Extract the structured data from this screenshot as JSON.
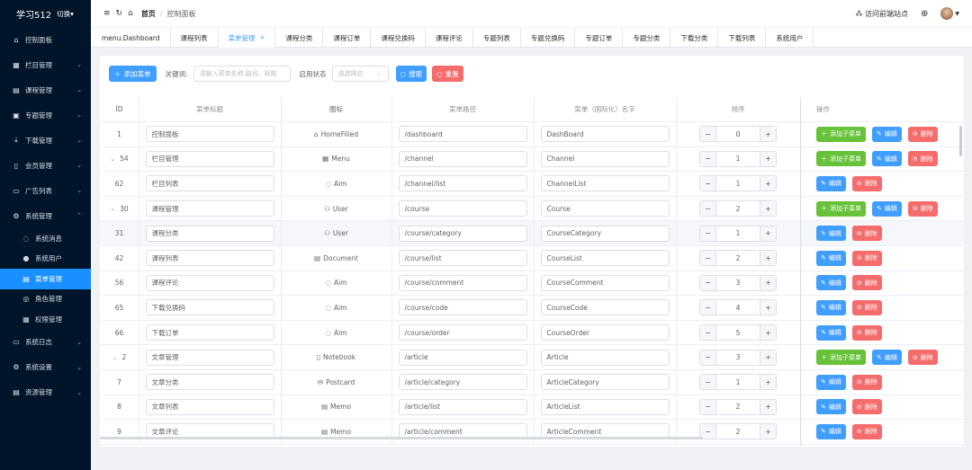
{
  "sidebar": {
    "logo": "学习512",
    "switch_label": "切换▾",
    "items": [
      {
        "label": "控制面板",
        "icon": "home-icon",
        "glyph": "⌂",
        "arrow": ""
      },
      {
        "label": "栏目管理",
        "icon": "grid-icon",
        "glyph": "▦",
        "arrow": "⌄"
      },
      {
        "label": "课程管理",
        "icon": "book-icon",
        "glyph": "▤",
        "arrow": "⌄"
      },
      {
        "label": "专题管理",
        "icon": "topic-icon",
        "glyph": "▣",
        "arrow": "⌄"
      },
      {
        "label": "下载管理",
        "icon": "download-icon",
        "glyph": "⤓",
        "arrow": "⌄"
      },
      {
        "label": "会员管理",
        "icon": "member-icon",
        "glyph": "▯",
        "arrow": "⌄"
      },
      {
        "label": "广告列表",
        "icon": "ad-icon",
        "glyph": "▭",
        "arrow": "⌄"
      },
      {
        "label": "系统管理",
        "icon": "settings-icon",
        "glyph": "⚙",
        "arrow": "⌃"
      }
    ],
    "sub_items": [
      {
        "label": "系统消息",
        "icon": "message-icon",
        "glyph": "◌"
      },
      {
        "label": "系统用户",
        "icon": "user-icon",
        "glyph": "●"
      },
      {
        "label": "菜单管理",
        "icon": "menu-icon",
        "glyph": "▤"
      },
      {
        "label": "角色管理",
        "icon": "role-icon",
        "glyph": "◎"
      },
      {
        "label": "权限管理",
        "icon": "permission-icon",
        "glyph": "▦"
      }
    ],
    "items_after": [
      {
        "label": "系统日志",
        "icon": "log-icon",
        "glyph": "▭",
        "arrow": "⌄"
      },
      {
        "label": "系统设置",
        "icon": "system-settings-icon",
        "glyph": "⚙",
        "arrow": "⌄"
      },
      {
        "label": "资源管理",
        "icon": "resource-icon",
        "glyph": "▤",
        "arrow": "⌄"
      }
    ]
  },
  "header": {
    "breadcrumb_home": "首页",
    "breadcrumb_current": "控制面板",
    "visit_site": "访问前端站点"
  },
  "tabs": [
    {
      "label": "menu.Dashboard",
      "active": false
    },
    {
      "label": "课程列表",
      "active": false
    },
    {
      "label": "菜单管理",
      "active": true
    },
    {
      "label": "课程分类",
      "active": false
    },
    {
      "label": "课程订单",
      "active": false
    },
    {
      "label": "课程兑换码",
      "active": false
    },
    {
      "label": "课程评论",
      "active": false
    },
    {
      "label": "专题列表",
      "active": false
    },
    {
      "label": "专题兑换码",
      "active": false
    },
    {
      "label": "专题订单",
      "active": false
    },
    {
      "label": "专题分类",
      "active": false
    },
    {
      "label": "下载分类",
      "active": false
    },
    {
      "label": "下载列表",
      "active": false
    },
    {
      "label": "系统用户",
      "active": false
    }
  ],
  "toolbar": {
    "add_label": "添加菜单",
    "keyword_label": "关键词:",
    "keyword_placeholder": "请输入菜单名称,路径、标题",
    "status_label": "启用状态",
    "status_placeholder": "请选择启",
    "search_label": "搜索",
    "reset_label": "重置"
  },
  "table": {
    "headers": {
      "id": "ID",
      "title": "菜单标题",
      "icon": "图标",
      "path": "菜单路径",
      "name": "菜单（国际化）名字",
      "sort": "排序",
      "ops": "操作"
    },
    "buttons": {
      "add_child": "添加子菜单",
      "edit": "编辑",
      "delete": "删除"
    },
    "rows": [
      {
        "id": "1",
        "expand": "",
        "title": "控制面板",
        "icon_glyph": "⌂",
        "icon": "HomeFilled",
        "path": "/dashboard",
        "name": "DashBoard",
        "sort": "0",
        "add_child": true
      },
      {
        "id": "54",
        "expand": "⌄",
        "title": "栏目管理",
        "icon_glyph": "▦",
        "icon": "Menu",
        "path": "/channel",
        "name": "Channel",
        "sort": "1",
        "add_child": true
      },
      {
        "id": "62",
        "expand": "",
        "title": "栏目列表",
        "icon_glyph": "◌",
        "icon": "Aim",
        "path": "/channel/list",
        "name": "ChannelList",
        "sort": "1",
        "add_child": false
      },
      {
        "id": "30",
        "expand": "⌄",
        "title": "课程管理",
        "icon_glyph": "⚇",
        "icon": "User",
        "path": "/course",
        "name": "Course",
        "sort": "2",
        "add_child": true
      },
      {
        "id": "31",
        "expand": "",
        "title": "课程分类",
        "icon_glyph": "⚇",
        "icon": "User",
        "path": "/course/category",
        "name": "CourseCategory",
        "sort": "1",
        "add_child": false
      },
      {
        "id": "42",
        "expand": "",
        "title": "课程列表",
        "icon_glyph": "▤",
        "icon": "Document",
        "path": "/course/list",
        "name": "CourseList",
        "sort": "2",
        "add_child": false
      },
      {
        "id": "56",
        "expand": "",
        "title": "课程评论",
        "icon_glyph": "◌",
        "icon": "Aim",
        "path": "/course/comment",
        "name": "CourseComment",
        "sort": "3",
        "add_child": false
      },
      {
        "id": "65",
        "expand": "",
        "title": "下载兑换码",
        "icon_glyph": "◌",
        "icon": "Aim",
        "path": "/course/code",
        "name": "CourseCode",
        "sort": "4",
        "add_child": false
      },
      {
        "id": "66",
        "expand": "",
        "title": "下载订单",
        "icon_glyph": "◌",
        "icon": "Aim",
        "path": "/course/order",
        "name": "CourseOrder",
        "sort": "5",
        "add_child": false
      },
      {
        "id": "2",
        "expand": "⌄",
        "title": "文章管理",
        "icon_glyph": "▯",
        "icon": "Notebook",
        "path": "/article",
        "name": "Article",
        "sort": "3",
        "add_child": true
      },
      {
        "id": "7",
        "expand": "",
        "title": "文章分类",
        "icon_glyph": "✉",
        "icon": "Postcard",
        "path": "/article/category",
        "name": "ArticleCategory",
        "sort": "1",
        "add_child": false
      },
      {
        "id": "8",
        "expand": "",
        "title": "文章列表",
        "icon_glyph": "▤",
        "icon": "Memo",
        "path": "/article/list",
        "name": "ArticleList",
        "sort": "2",
        "add_child": false
      },
      {
        "id": "9",
        "expand": "",
        "title": "文章评论",
        "icon_glyph": "▤",
        "icon": "Memo",
        "path": "/article/comment",
        "name": "ArticleComment",
        "sort": "2",
        "add_child": false
      }
    ]
  },
  "colors": {
    "sidebar_bg": "#001529",
    "active_blue": "#1890ff",
    "primary": "#409eff",
    "success": "#67c23a",
    "danger": "#f56c6c"
  }
}
